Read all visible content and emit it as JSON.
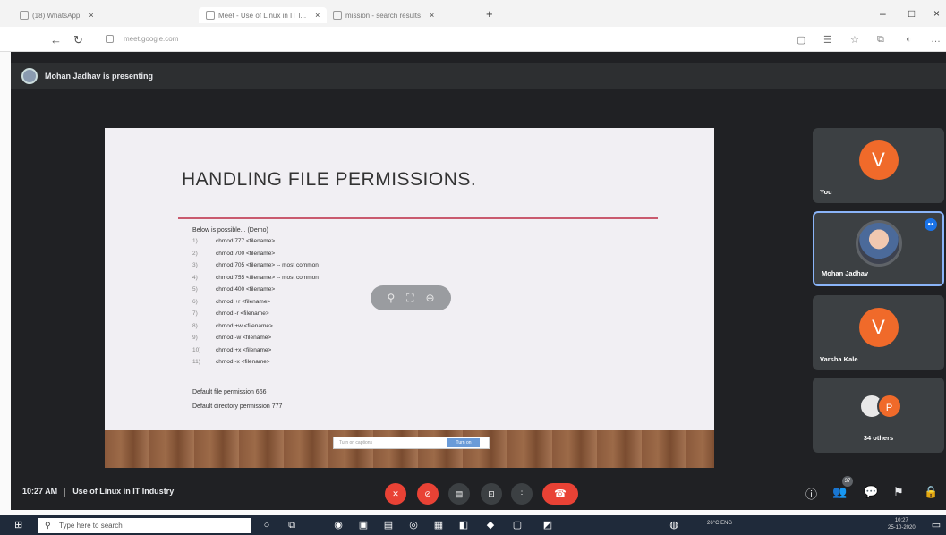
{
  "browser": {
    "tabs": [
      {
        "label": "(18) WhatsApp"
      },
      {
        "label": "Meet - Use of Linux in IT I..."
      },
      {
        "label": "mission - search results"
      }
    ],
    "url": "meet.google.com",
    "new_tab_glyph": "+",
    "controls": {
      "minimize": "–",
      "maximize": "□",
      "close": "×"
    }
  },
  "meet": {
    "presenting_text": "Mohan Jadhav is presenting",
    "meeting_time": "10:27 AM",
    "meeting_name": "Use of Linux in IT Industry"
  },
  "slide": {
    "title": "HANDLING FILE PERMISSIONS.",
    "intro": "Below is possible... (Demo)",
    "commands": [
      {
        "n": "1)",
        "text": "chmod 777 <filename>"
      },
      {
        "n": "2)",
        "text": "chmod 700 <filename>"
      },
      {
        "n": "3)",
        "text": "chmod 705 <filename>  -- most common"
      },
      {
        "n": "4)",
        "text": "chmod 755 <filename>  -- most common"
      },
      {
        "n": "5)",
        "text": "chmod 400 <filename>"
      },
      {
        "n": "6)",
        "text": "chmod +r <filename>"
      },
      {
        "n": "7)",
        "text": "chmod -r <filename>"
      },
      {
        "n": "8)",
        "text": "chmod +w <filename>"
      },
      {
        "n": "9)",
        "text": "chmod -w <filename>"
      },
      {
        "n": "10)",
        "text": "chmod +x <filename>"
      },
      {
        "n": "11)",
        "text": "chmod -x <filename>"
      }
    ],
    "default_file": "Default file permission 666",
    "default_dir": "Default directory permission 777",
    "caption_text": "Turn on captions",
    "caption_button": "Turn on"
  },
  "participants": [
    {
      "name": "You",
      "initial": "V",
      "color": "#f06a2a"
    },
    {
      "name": "Mohan Jadhav",
      "initial": "",
      "color": "#5f6368"
    },
    {
      "name": "Varsha Kale",
      "initial": "V",
      "color": "#f06a2a"
    },
    {
      "name": "34 others",
      "initial": "P",
      "color": "#f06a2a"
    }
  ],
  "taskbar": {
    "search_placeholder": "Type here to search",
    "tray_text": "26°C  ENG",
    "time": "10:27",
    "date": "25-10-2020"
  },
  "icons": {
    "more": "⋮",
    "mic": "🎤",
    "camera": "📷",
    "hangup": "☎",
    "info": "ⓘ",
    "people": "👥",
    "chat": "💬",
    "activities": "⚑",
    "lock": "🔒"
  }
}
